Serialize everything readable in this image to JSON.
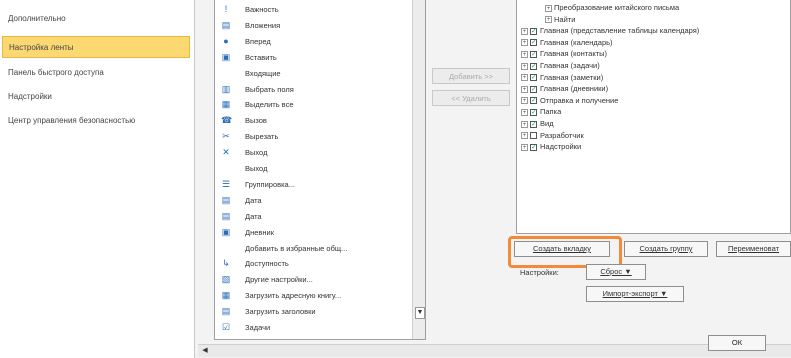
{
  "nav": {
    "items": [
      {
        "label": "Дополнительно",
        "selected": false
      },
      {
        "label": "Настройка ленты",
        "selected": true
      },
      {
        "label": "Панель быстрого доступа",
        "selected": false
      },
      {
        "label": "Надстройки",
        "selected": false
      },
      {
        "label": "Центр управления безопасностью",
        "selected": false
      }
    ]
  },
  "commands": [
    {
      "icon": "flag-icon",
      "glyph": "!",
      "label": "Важность"
    },
    {
      "icon": "attachment-icon",
      "glyph": "▤",
      "label": "Вложения"
    },
    {
      "icon": "forward-icon",
      "glyph": "●",
      "label": "Вперед"
    },
    {
      "icon": "paste-icon",
      "glyph": "▣",
      "label": "Вставить"
    },
    {
      "icon": "",
      "glyph": "",
      "label": "Входящие"
    },
    {
      "icon": "select-field-icon",
      "glyph": "▥",
      "label": "Выбрать поля"
    },
    {
      "icon": "select-all-icon",
      "glyph": "▦",
      "label": "Выделить все"
    },
    {
      "icon": "call-icon",
      "glyph": "☎",
      "label": "Вызов"
    },
    {
      "icon": "cut-icon",
      "glyph": "✂",
      "label": "Вырезать"
    },
    {
      "icon": "exit-icon",
      "glyph": "✕",
      "label": "Выход"
    },
    {
      "icon": "",
      "glyph": "",
      "label": "Выход"
    },
    {
      "icon": "group-icon",
      "glyph": "☰",
      "label": "Группировка..."
    },
    {
      "icon": "date-icon",
      "glyph": "▤",
      "label": "Дата"
    },
    {
      "icon": "date-icon",
      "glyph": "▤",
      "label": "Дата"
    },
    {
      "icon": "journal-icon",
      "glyph": "▣",
      "label": "Дневник"
    },
    {
      "icon": "",
      "glyph": "",
      "label": "Добавить в избранные общ..."
    },
    {
      "icon": "access-icon",
      "glyph": "↳",
      "label": "Доступность"
    },
    {
      "icon": "settings-icon",
      "glyph": "▧",
      "label": "Другие настройки..."
    },
    {
      "icon": "address-book-icon",
      "glyph": "▦",
      "label": "Загрузить адресную книгу..."
    },
    {
      "icon": "download-headers-icon",
      "glyph": "▤",
      "label": "Загрузить заголовки"
    },
    {
      "icon": "tasks-icon",
      "glyph": "☑",
      "label": "Задачи"
    }
  ],
  "middle": {
    "add_label": "Добавить >>",
    "remove_label": "<< Удалить"
  },
  "tree": {
    "items": [
      {
        "indent": 2,
        "pm": "+",
        "checkbox": false,
        "checked": false,
        "label": "Преобразование китайского письма"
      },
      {
        "indent": 2,
        "pm": "+",
        "checkbox": false,
        "checked": false,
        "label": "Найти"
      },
      {
        "indent": 0,
        "pm": "+",
        "checkbox": true,
        "checked": true,
        "label": "Главная (представление таблицы календаря)"
      },
      {
        "indent": 0,
        "pm": "+",
        "checkbox": true,
        "checked": true,
        "label": "Главная (календарь)"
      },
      {
        "indent": 0,
        "pm": "+",
        "checkbox": true,
        "checked": true,
        "label": "Главная (контакты)"
      },
      {
        "indent": 0,
        "pm": "+",
        "checkbox": true,
        "checked": true,
        "label": "Главная (задачи)"
      },
      {
        "indent": 0,
        "pm": "+",
        "checkbox": true,
        "checked": true,
        "label": "Главная (заметки)"
      },
      {
        "indent": 0,
        "pm": "+",
        "checkbox": true,
        "checked": true,
        "label": "Главная (дневники)"
      },
      {
        "indent": 0,
        "pm": "+",
        "checkbox": true,
        "checked": true,
        "label": "Отправка и получение"
      },
      {
        "indent": 0,
        "pm": "+",
        "checkbox": true,
        "checked": true,
        "label": "Папка"
      },
      {
        "indent": 0,
        "pm": "+",
        "checkbox": true,
        "checked": true,
        "label": "Вид"
      },
      {
        "indent": 0,
        "pm": "+",
        "checkbox": true,
        "checked": false,
        "label": "Разработчик"
      },
      {
        "indent": 0,
        "pm": "+",
        "checkbox": true,
        "checked": true,
        "label": "Надстройки"
      }
    ]
  },
  "buttons": {
    "new_tab": "Создать вкладку",
    "new_group": "Создать группу",
    "rename": "Переименоват",
    "settings_label": "Настройки:",
    "reset": "Сброс ▼",
    "import_export": "Импорт-экспорт ▼",
    "ok": "ОК"
  },
  "colors": {
    "selected_nav": "#fbd872",
    "highlight": "#f28a3a"
  }
}
